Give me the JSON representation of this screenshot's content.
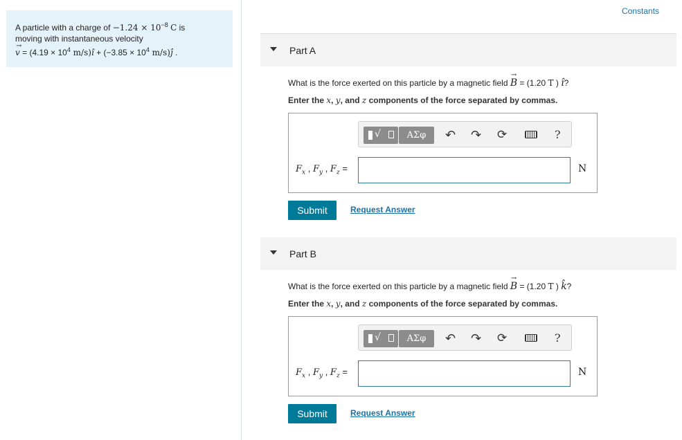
{
  "constants_link": "Constants",
  "problem": {
    "line1_prefix": "A particle with a charge of ",
    "charge_value": "−1.24 × 10",
    "charge_exp": "−8",
    "charge_unit": "C",
    "line1_suffix": " is",
    "line2": "moving with instantaneous velocity",
    "velocity_prefix": " = (4.19 × 10",
    "v_exp1": "4",
    "v_unit1": " m/s)",
    "v_mid": " + (−3.85 × 10",
    "v_exp2": "4",
    "v_unit2": " m/s)",
    "v_end": " ."
  },
  "parts": [
    {
      "title": "Part A",
      "question_prefix": "What is the force exerted on this particle by a magnetic field ",
      "field_value": " = (1.20 ",
      "field_unit": "T",
      "field_close": " ) ",
      "field_dir": "î",
      "question_suffix": "?",
      "instruction": "Enter the x, y, and z components of the force separated by commas.",
      "answer_label": "Fx , Fy , Fz =",
      "answer_value": "",
      "unit": "N",
      "submit": "Submit",
      "request": "Request Answer"
    },
    {
      "title": "Part B",
      "question_prefix": "What is the force exerted on this particle by a magnetic field ",
      "field_value": " = (1.20 ",
      "field_unit": "T",
      "field_close": " ) ",
      "field_dir": "k̂",
      "question_suffix": "?",
      "instruction": "Enter the x, y, and z components of the force separated by commas.",
      "answer_label": "Fx , Fy , Fz =",
      "answer_value": "",
      "unit": "N",
      "submit": "Submit",
      "request": "Request Answer"
    }
  ],
  "toolbar": {
    "greek": "ΑΣφ",
    "undo_icon": "↶",
    "redo_icon": "↷",
    "reset_icon": "⟳",
    "help": "?"
  },
  "icons": [
    "caret-down-icon",
    "templates-icon",
    "greek-icon",
    "undo-icon",
    "redo-icon",
    "reset-icon",
    "keyboard-icon",
    "help-icon"
  ]
}
